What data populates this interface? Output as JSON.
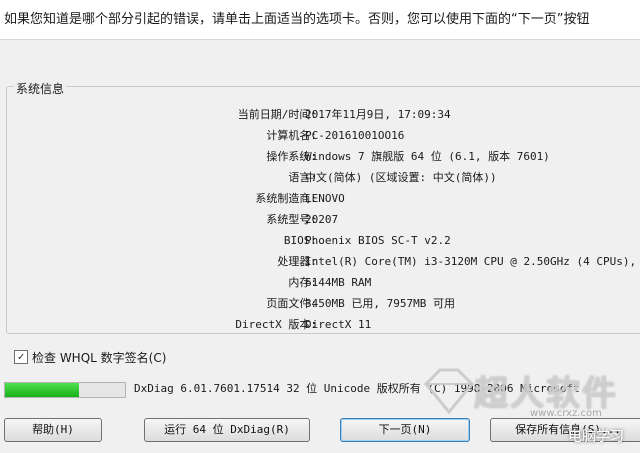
{
  "intro_text": "如果您知道是哪个部分引起的错误，请单击上面适当的选项卡。否则，您可以使用下面的“下一页”按钮",
  "system_info": {
    "title": "系统信息",
    "rows": [
      {
        "label": "当前日期/时间:",
        "value": "2017年11月9日, 17:09:34"
      },
      {
        "label": "计算机名:",
        "value": "PC-20161001OO16"
      },
      {
        "label": "操作系统:",
        "value": "Windows 7 旗舰版 64 位 (6.1, 版本 7601)"
      },
      {
        "label": "语言:",
        "value": "中文(简体) (区域设置: 中文(简体))"
      },
      {
        "label": "系统制造商:",
        "value": "LENOVO"
      },
      {
        "label": "系统型号:",
        "value": "20207"
      },
      {
        "label": "BIOS:",
        "value": "Phoenix BIOS SC-T v2.2"
      },
      {
        "label": "处理器:",
        "value": "Intel(R) Core(TM) i3-3120M CPU @ 2.50GHz (4 CPUs),"
      },
      {
        "label": "内存:",
        "value": "6144MB RAM"
      },
      {
        "label": "页面文件:",
        "value": "3450MB 已用, 7957MB 可用"
      },
      {
        "label": "DirectX 版本:",
        "value": "DirectX 11"
      }
    ]
  },
  "whql_check": {
    "label": "检查 WHQL 数字签名(C)",
    "checked": true,
    "mark": "✓"
  },
  "progress": {
    "fraction": 0.62
  },
  "version_text": "DxDiag 6.01.7601.17514 32 位 Unicode 版权所有 (C) 1998-2006 Microsoft",
  "buttons": {
    "help": "帮助(H)",
    "run64": "运行 64 位 DxDiag(R)",
    "next": "下一页(N)",
    "save": "保存所有信息(S)..."
  },
  "watermark": {
    "brand": "超人软件",
    "url": "www.crxz.com",
    "author": "电脑学习"
  }
}
